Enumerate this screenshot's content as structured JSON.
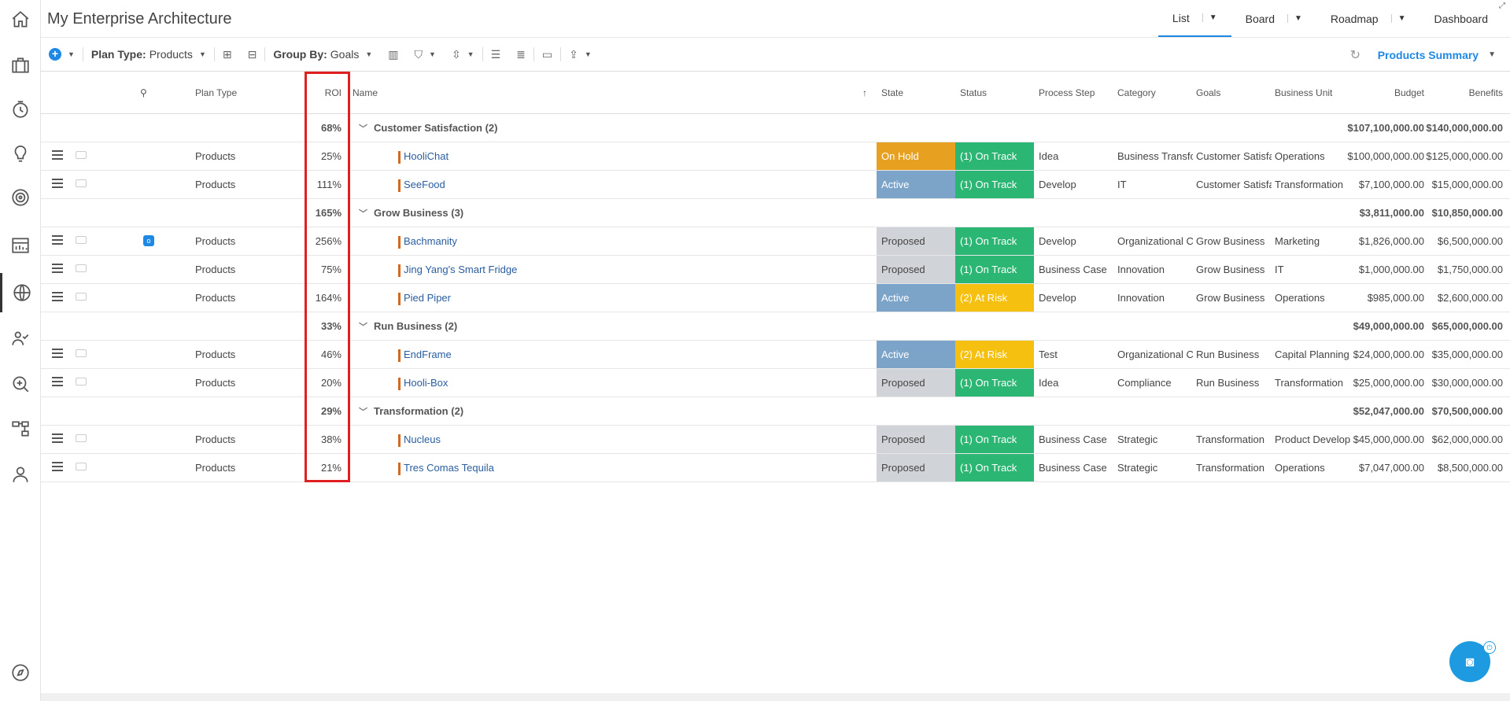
{
  "header": {
    "title": "My Enterprise Architecture",
    "views": [
      {
        "label": "List",
        "active": true
      },
      {
        "label": "Board"
      },
      {
        "label": "Roadmap"
      },
      {
        "label": "Dashboard"
      }
    ]
  },
  "toolbar": {
    "plan_type_label": "Plan Type:",
    "plan_type_value": "Products",
    "group_by_label": "Group By:",
    "group_by_value": "Goals",
    "summary_label": "Products Summary"
  },
  "columns": {
    "plan_type": "Plan Type",
    "roi": "ROI",
    "name": "Name",
    "state": "State",
    "status": "Status",
    "process_step": "Process Step",
    "category": "Category",
    "goals": "Goals",
    "business_unit": "Business Unit",
    "budget": "Budget",
    "benefits": "Benefits"
  },
  "groups": [
    {
      "name": "Customer Satisfaction (2)",
      "roi": "68%",
      "budget": "$107,100,000.00",
      "benefits": "$140,000,000.00",
      "rows": [
        {
          "plan_type": "Products",
          "roi": "25%",
          "name": "HooliChat",
          "state": "On Hold",
          "status": "(1) On Track",
          "process_step": "Idea",
          "category": "Business Transfo",
          "goals": "Customer Satisfa",
          "business_unit": "Operations",
          "budget": "$100,000,000.00",
          "benefits": "$125,000,000.00"
        },
        {
          "plan_type": "Products",
          "roi": "111%",
          "name": "SeeFood",
          "state": "Active",
          "status": "(1) On Track",
          "process_step": "Develop",
          "category": "IT",
          "goals": "Customer Satisfa",
          "business_unit": "Transformation",
          "budget": "$7,100,000.00",
          "benefits": "$15,000,000.00"
        }
      ]
    },
    {
      "name": "Grow Business (3)",
      "roi": "165%",
      "budget": "$3,811,000.00",
      "benefits": "$10,850,000.00",
      "rows": [
        {
          "plan_type": "Products",
          "roi": "256%",
          "name": "Bachmanity",
          "state": "Proposed",
          "status": "(1) On Track",
          "process_step": "Develop",
          "category": "Organizational C",
          "goals": "Grow Business",
          "business_unit": "Marketing",
          "budget": "$1,826,000.00",
          "benefits": "$6,500,000.00",
          "flag": "o"
        },
        {
          "plan_type": "Products",
          "roi": "75%",
          "name": "Jing Yang's Smart Fridge",
          "state": "Proposed",
          "status": "(1) On Track",
          "process_step": "Business Case",
          "category": "Innovation",
          "goals": "Grow Business",
          "business_unit": "IT",
          "budget": "$1,000,000.00",
          "benefits": "$1,750,000.00"
        },
        {
          "plan_type": "Products",
          "roi": "164%",
          "name": "Pied Piper",
          "state": "Active",
          "status": "(2) At Risk",
          "process_step": "Develop",
          "category": "Innovation",
          "goals": "Grow Business",
          "business_unit": "Operations",
          "budget": "$985,000.00",
          "benefits": "$2,600,000.00"
        }
      ]
    },
    {
      "name": "Run Business (2)",
      "roi": "33%",
      "budget": "$49,000,000.00",
      "benefits": "$65,000,000.00",
      "rows": [
        {
          "plan_type": "Products",
          "roi": "46%",
          "name": "EndFrame",
          "state": "Active",
          "status": "(2) At Risk",
          "process_step": "Test",
          "category": "Organizational C",
          "goals": "Run Business",
          "business_unit": "Capital Planning",
          "budget": "$24,000,000.00",
          "benefits": "$35,000,000.00"
        },
        {
          "plan_type": "Products",
          "roi": "20%",
          "name": "Hooli-Box",
          "state": "Proposed",
          "status": "(1) On Track",
          "process_step": "Idea",
          "category": "Compliance",
          "goals": "Run Business",
          "business_unit": "Transformation",
          "budget": "$25,000,000.00",
          "benefits": "$30,000,000.00"
        }
      ]
    },
    {
      "name": "Transformation (2)",
      "roi": "29%",
      "budget": "$52,047,000.00",
      "benefits": "$70,500,000.00",
      "rows": [
        {
          "plan_type": "Products",
          "roi": "38%",
          "name": "Nucleus",
          "state": "Proposed",
          "status": "(1) On Track",
          "process_step": "Business Case",
          "category": "Strategic",
          "goals": "Transformation",
          "business_unit": "Product Develop",
          "budget": "$45,000,000.00",
          "benefits": "$62,000,000.00"
        },
        {
          "plan_type": "Products",
          "roi": "21%",
          "name": "Tres Comas Tequila",
          "state": "Proposed",
          "status": "(1) On Track",
          "process_step": "Business Case",
          "category": "Strategic",
          "goals": "Transformation",
          "business_unit": "Operations",
          "budget": "$7,047,000.00",
          "benefits": "$8,500,000.00"
        }
      ]
    }
  ],
  "colors": {
    "On Hold": "#e8a020",
    "Active": "#7ba4c8",
    "Proposed": "#d0d3d8",
    "(1) On Track": "#2bb673",
    "(2) At Risk": "#f5c010"
  }
}
